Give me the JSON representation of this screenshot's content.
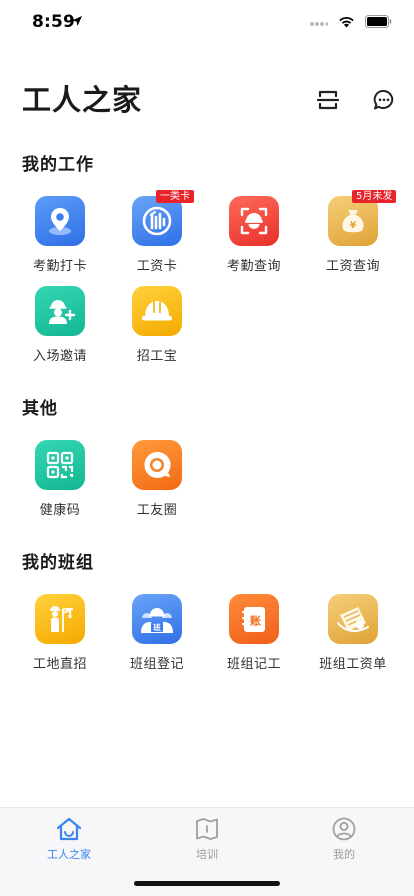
{
  "status_bar": {
    "time": "8:59"
  },
  "header": {
    "title": "工人之家"
  },
  "sections": {
    "my_work": {
      "title": "我的工作"
    },
    "other": {
      "title": "其他"
    },
    "my_team": {
      "title": "我的班组"
    }
  },
  "my_work_items": [
    {
      "label": "考勤打卡",
      "icon": "location-pin-icon"
    },
    {
      "label": "工资卡",
      "icon": "bank-card-icon",
      "badge": "一类卡"
    },
    {
      "label": "考勤查询",
      "icon": "face-scan-icon"
    },
    {
      "label": "工资查询",
      "icon": "money-bag-icon",
      "badge": "5月未发"
    },
    {
      "label": "入场邀请",
      "icon": "worker-add-icon"
    },
    {
      "label": "招工宝",
      "icon": "hard-hat-icon"
    }
  ],
  "other_items": [
    {
      "label": "健康码",
      "icon": "qr-code-icon"
    },
    {
      "label": "工友圈",
      "icon": "chat-circle-icon"
    }
  ],
  "team_items": [
    {
      "label": "工地直招",
      "icon": "construction-worker-icon"
    },
    {
      "label": "班组登记",
      "icon": "team-register-icon",
      "badge_text": "班"
    },
    {
      "label": "班组记工",
      "icon": "ledger-icon",
      "badge_text": "账"
    },
    {
      "label": "班组工资单",
      "icon": "payslip-icon"
    }
  ],
  "tabbar": {
    "tabs": [
      {
        "label": "工人之家",
        "icon": "home-icon",
        "active": true
      },
      {
        "label": "培训",
        "icon": "book-icon",
        "active": false
      },
      {
        "label": "我的",
        "icon": "profile-icon",
        "active": false
      }
    ]
  },
  "colors": {
    "accent": "#3b86ee",
    "badge": "#e8232a"
  }
}
